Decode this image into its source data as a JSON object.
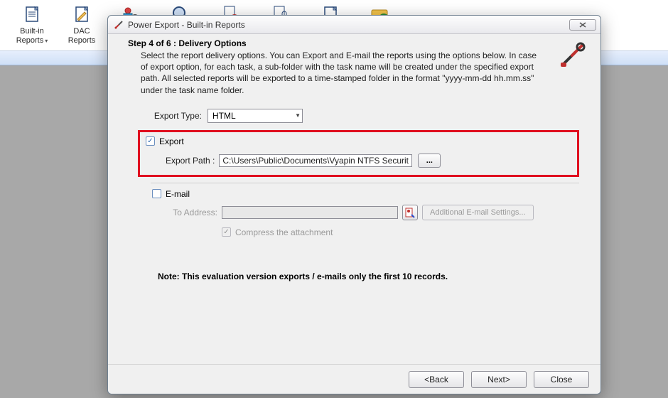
{
  "ribbon": {
    "items": [
      {
        "label": "Built-in\nReports",
        "has_dropdown": true
      },
      {
        "label": "DAC\nReports",
        "has_dropdown": false
      },
      {
        "label": "",
        "has_dropdown": false
      },
      {
        "label": "",
        "has_dropdown": false
      },
      {
        "label": "",
        "has_dropdown": false
      },
      {
        "label": "",
        "has_dropdown": false
      },
      {
        "label": "",
        "has_dropdown": false
      },
      {
        "label": "",
        "has_dropdown": false
      }
    ]
  },
  "dialog": {
    "title": "Power Export - Built-in Reports",
    "step_title": "Step 4 of 6  : Delivery Options",
    "step_desc": "Select the report delivery options. You can Export and E-mail the reports using the options below. In case of export option, for each task, a sub-folder with the task name will be created under the specified export path. All selected reports will be exported to a time-stamped folder in the format \"yyyy-mm-dd hh.mm.ss\" under the task name folder.",
    "export_type_label": "Export Type:",
    "export_type_value": "HTML",
    "export_checkbox_label": "Export",
    "export_checked": true,
    "export_path_label": "Export Path :",
    "export_path_value": "C:\\Users\\Public\\Documents\\Vyapin NTFS Security Man",
    "browse_label": "...",
    "email_checkbox_label": "E-mail",
    "email_checked": false,
    "to_address_label": "To Address:",
    "to_address_value": "",
    "additional_email_label": "Additional E-mail Settings...",
    "compress_label": "Compress the attachment",
    "compress_checked": true,
    "note": "Note: This evaluation version exports / e-mails only the first 10 records.",
    "buttons": {
      "back": "<Back",
      "next": "Next>",
      "close": "Close"
    }
  }
}
